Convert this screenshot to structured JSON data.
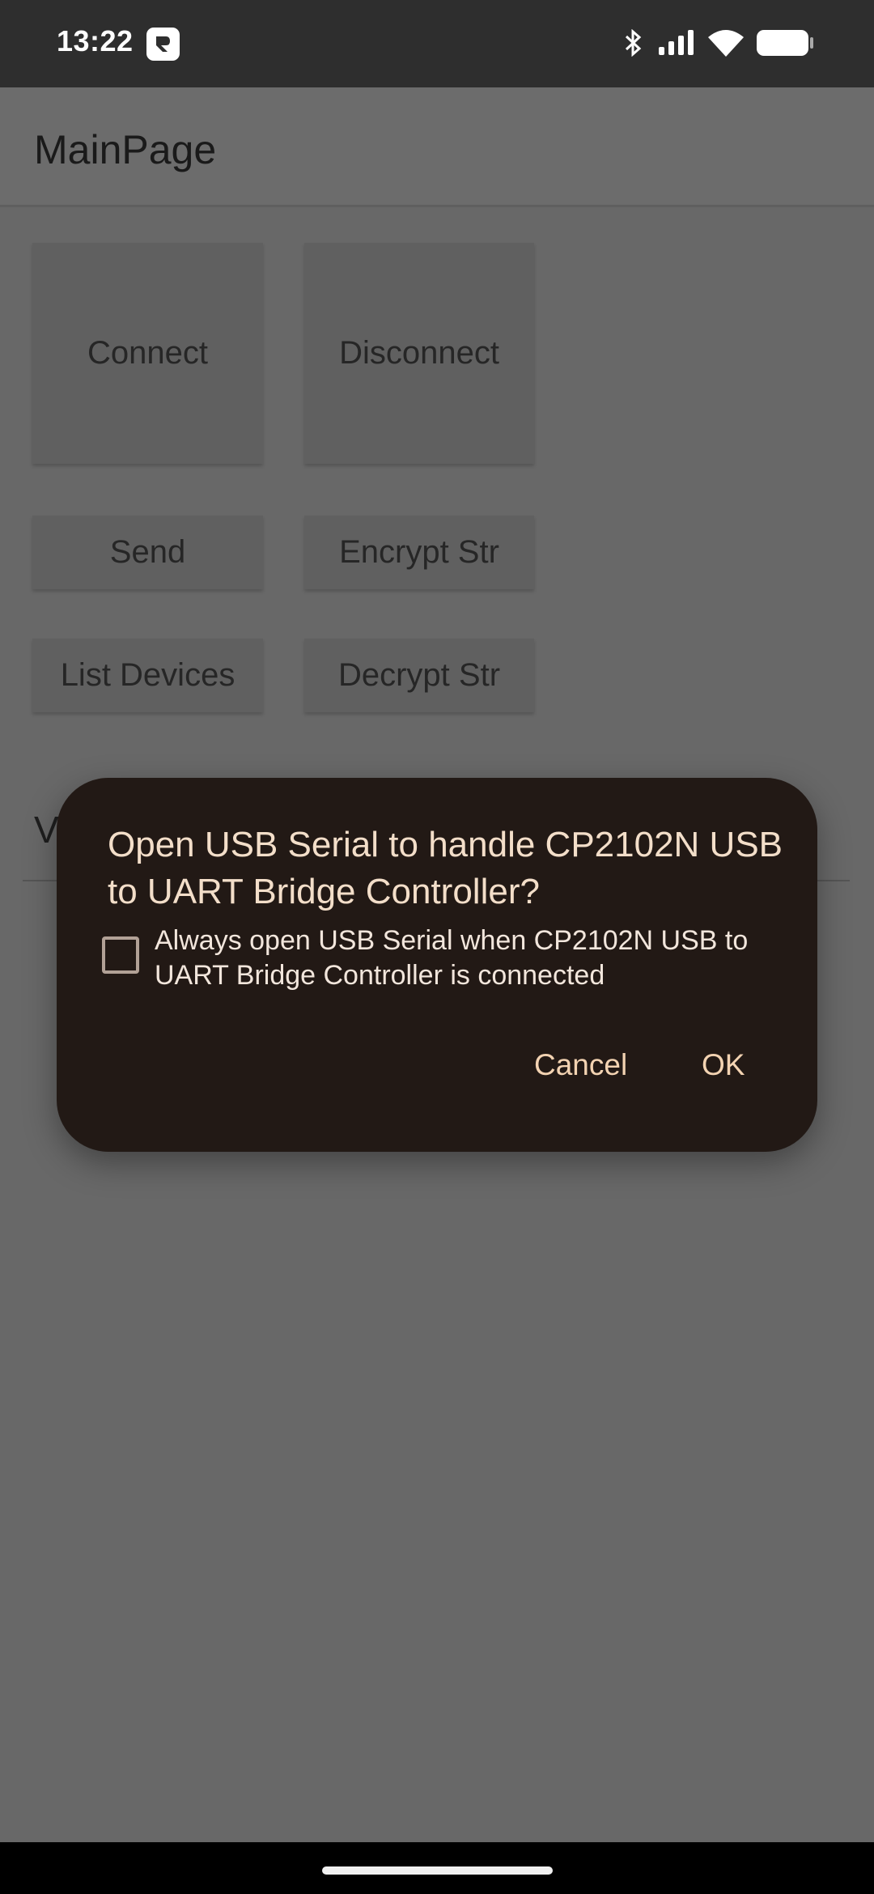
{
  "status_bar": {
    "time": "13:22",
    "icons": [
      "app-badge-icon",
      "bluetooth-icon",
      "signal-icon",
      "wifi-icon",
      "battery-icon"
    ]
  },
  "app_bar": {
    "title": "MainPage"
  },
  "buttons": {
    "connect": "Connect",
    "disconnect": "Disconnect",
    "send": "Send",
    "encrypt": "Encrypt Str",
    "list_devices": "List Devices",
    "decrypt": "Decrypt Str"
  },
  "partial_label": "V",
  "dialog": {
    "title": "Open USB Serial to handle CP2102N USB to UART Bridge Controller?",
    "checkbox_label": "Always open USB Serial when CP2102N USB to UART Bridge Controller is connected",
    "checkbox_checked": false,
    "cancel": "Cancel",
    "ok": "OK"
  },
  "colors": {
    "dialog_bg": "#221915",
    "dialog_title": "#f3dec9",
    "dialog_action": "#f3d3b2",
    "scrim": "#686868"
  }
}
